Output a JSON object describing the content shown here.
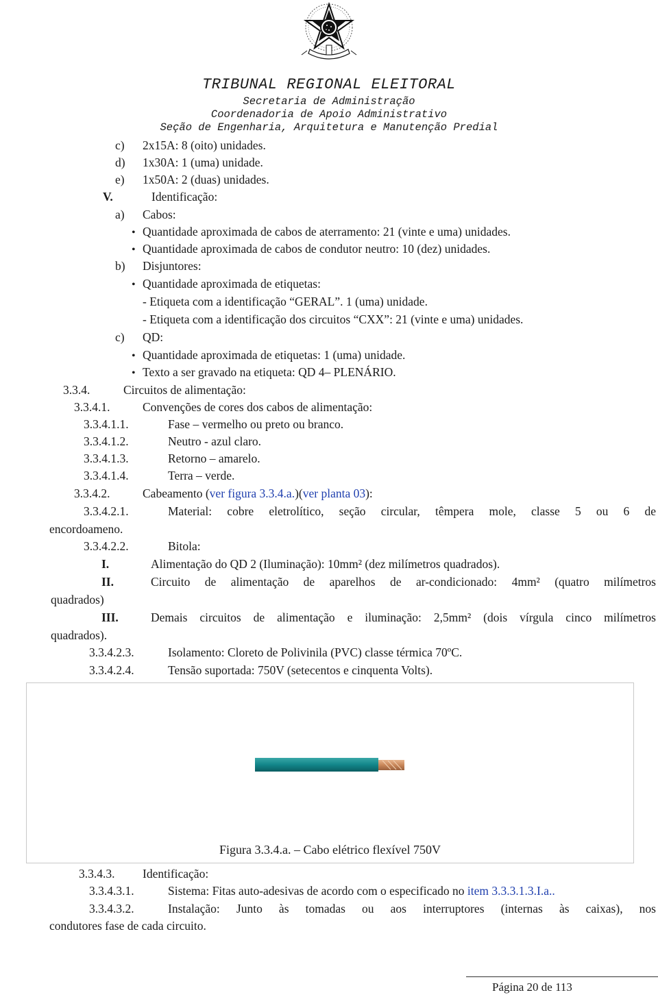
{
  "header": {
    "emblem": "brazil-coat-of-arms",
    "org": "TRIBUNAL REGIONAL ELEITORAL",
    "line1": "Secretaria de Administração",
    "line2": "Coordenadoria de Apoio Administrativo",
    "line3": "Seção de Engenharia, Arquitetura e Manutenção Predial"
  },
  "list_top": [
    {
      "marker": "c)",
      "text": "2x15A: 8 (oito) unidades."
    },
    {
      "marker": "d)",
      "text": "1x30A: 1 (uma) unidade."
    },
    {
      "marker": "e)",
      "text": "1x50A: 2 (duas) unidades."
    }
  ],
  "section_v": {
    "marker": "V.",
    "text": "Identificação:"
  },
  "cabos": {
    "marker": "a)",
    "text": "Cabos:",
    "bullets": [
      "Quantidade aproximada de cabos de aterramento: 21 (vinte e uma) unidades.",
      "Quantidade aproximada de cabos de condutor neutro: 10 (dez) unidades."
    ]
  },
  "disjuntores": {
    "marker": "b)",
    "text": "Disjuntores:",
    "bullet": "Quantidade aproximada de etiquetas:",
    "sub": [
      "- Etiqueta com a identificação “GERAL”. 1 (uma) unidade.",
      "- Etiqueta com a identificação dos circuitos “CXX”: 21 (vinte e uma) unidades."
    ]
  },
  "qd": {
    "marker": "c)",
    "text": "QD:",
    "bullets": [
      "Quantidade aproximada de etiquetas: 1 (uma) unidade.",
      "Texto a ser gravado na etiqueta: QD 4– PLENÁRIO."
    ]
  },
  "s334": {
    "num": "3.3.4.",
    "text": "Circuitos de alimentação:"
  },
  "s3341": {
    "num": "3.3.4.1.",
    "text": "Convenções de cores dos cabos de alimentação:"
  },
  "cores": [
    {
      "num": "3.3.4.1.1.",
      "text": "Fase – vermelho ou preto ou branco."
    },
    {
      "num": "3.3.4.1.2.",
      "text": "Neutro - azul claro."
    },
    {
      "num": "3.3.4.1.3.",
      "text": "Retorno – amarelo."
    },
    {
      "num": "3.3.4.1.4.",
      "text": "Terra – verde."
    }
  ],
  "s3342": {
    "num": "3.3.4.2.",
    "text": "Cabeamento (",
    "link1": "ver figura 3.3.4.a.",
    "mid": ")(",
    "link2": "ver planta 03",
    "end": "):"
  },
  "s33421": {
    "num": "3.3.4.2.1.",
    "line1": "Material: cobre eletrolítico, seção circular, têmpera mole, classe 5 ou 6 de",
    "line2": "encordoameno."
  },
  "s33422": {
    "num": "3.3.4.2.2.",
    "text": "Bitola:"
  },
  "bitola": [
    {
      "marker": "I.",
      "line1": "Alimentação do QD 2 (Iluminação): 10mm² (dez milímetros quadrados).",
      "line2": ""
    },
    {
      "marker": "II.",
      "line1": "Circuito de alimentação de aparelhos de ar-condicionado: 4mm² (quatro milímetros",
      "line2": "quadrados)"
    },
    {
      "marker": "III.",
      "line1": "Demais circuitos de alimentação e iluminação: 2,5mm² (dois vírgula cinco milímetros",
      "line2": "quadrados)."
    }
  ],
  "s33423": {
    "num": "3.3.4.2.3.",
    "text": "Isolamento: Cloreto de Polivinila (PVC) classe térmica 70ºC."
  },
  "s33424": {
    "num": "3.3.4.2.4.",
    "text": "Tensão suportada: 750V (setecentos e cinquenta Volts)."
  },
  "figure": {
    "image": "green-flexible-cable-photo",
    "caption": "Figura 3.3.4.a. – Cabo elétrico flexível 750V",
    "cable_color": "#12868a",
    "copper_color": "#c9875a"
  },
  "s3343": {
    "num": "3.3.4.3.",
    "text": "Identificação:"
  },
  "s33431": {
    "num": "3.3.4.3.1.",
    "text": "Sistema: Fitas auto-adesivas de acordo com o especificado no ",
    "link": "item 3.3.3.1.3.I.a.."
  },
  "s33432": {
    "num": "3.3.4.3.2.",
    "line1": "Instalação: Junto às tomadas ou aos interruptores (internas às caixas), nos",
    "line2": "condutores fase de cada circuito."
  },
  "footer": {
    "page": "Página 20 de 113"
  },
  "colors": {
    "link": "#1f3fae",
    "text": "#1a1a1a"
  }
}
